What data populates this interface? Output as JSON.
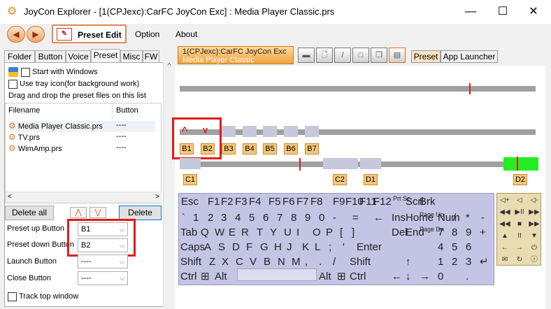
{
  "window": {
    "title": "JoyCon Explorer - [1(CPJexc):CarFC JoyCon Exc] : Media Player Classic.prs",
    "minimize": "—",
    "maximize": "☐",
    "close": "✕"
  },
  "menubar": {
    "back": "◀",
    "forward": "▶",
    "preset_edit": "Preset Edit",
    "option": "Option",
    "about": "About"
  },
  "left_tabs": [
    "Folder",
    "Button",
    "Voice",
    "Preset",
    "Misc",
    "FW"
  ],
  "left_panel": {
    "start_with_windows": "Start with Windows",
    "use_tray": "Use tray icon(for background work)",
    "drag_hint": "Drag and drop the preset files on this list",
    "col_filename": "Filename",
    "col_button": "Button",
    "files": [
      {
        "name": "Media Player Classic.prs",
        "button": "----"
      },
      {
        "name": "TV.prs",
        "button": "----"
      },
      {
        "name": "WimAmp.prs",
        "button": "----"
      }
    ],
    "delete_all": "Delete all",
    "up": "⋀",
    "down": "⋁",
    "delete": "Delete",
    "preset_up_label": "Preset up Button",
    "preset_up_value": "B1",
    "preset_down_label": "Preset down Button",
    "preset_down_value": "B2",
    "launch_label": "Launch Button",
    "launch_value": "----",
    "close_label": "Close Button",
    "close_value": "----",
    "track_top": "Track top window"
  },
  "right": {
    "active_tab_line1": "1(CPJexc):CarFC JoyCon Exc",
    "active_tab_line2": "Media Player Classic",
    "tab_preset": "Preset",
    "tab_launcher": "App Launcher",
    "buttons": [
      "B1",
      "B2",
      "B3",
      "B4",
      "B5",
      "B6",
      "B7"
    ],
    "lower_labels": [
      "C1",
      "C2",
      "D1",
      "D2"
    ],
    "up_caret": "^",
    "down_caret": "v"
  },
  "keyboard": {
    "row0": [
      "Esc",
      "F1",
      "F2",
      "F3",
      "F4",
      "F5",
      "F6",
      "F7",
      "F8",
      "F9",
      "F10",
      "F11",
      "F12",
      "Prt Sc",
      "Scrl",
      "Brk"
    ],
    "row1": [
      "`",
      "1",
      "2",
      "3",
      "4",
      "5",
      "6",
      "7",
      "8",
      "9",
      "0",
      "-",
      "=",
      "←",
      "Ins",
      "Home",
      "Page Up",
      "Num",
      "/",
      "*",
      "-"
    ],
    "row2": [
      "Tab",
      "Q",
      "W",
      "E",
      "R",
      "T",
      "Y",
      "U",
      "I",
      "O",
      "P",
      "[",
      "]",
      "Del",
      "End",
      "Page Dn",
      "7",
      "8",
      "9",
      "+"
    ],
    "row3": [
      "Caps",
      "A",
      "S",
      "D",
      "F",
      "G",
      "H",
      "J",
      "K",
      "L",
      ";",
      "'",
      "Enter",
      "4",
      "5",
      "6"
    ],
    "row4": [
      "Shift",
      "Z",
      "X",
      "C",
      "V",
      "B",
      "N",
      "M",
      ",",
      ".",
      "/",
      "Shift",
      "↑",
      "1",
      "2",
      "3",
      "↵"
    ],
    "row5": [
      "Ctrl",
      "⊞",
      "Alt",
      "Alt",
      "⊞",
      "Ctrl",
      "←",
      "↓",
      "→",
      "0",
      "."
    ]
  },
  "media_keys": [
    "◁+",
    "◁",
    "◁-",
    "◀◀",
    "▶II",
    "▶▶",
    "◀◀",
    "■",
    "▶▶",
    "▲",
    "II",
    "▼",
    "←",
    "→",
    "⏻",
    "✉",
    "↻",
    "ⓘ"
  ],
  "colors": {
    "accent": "#f0a23c",
    "highlight": "#e31a1a",
    "green": "#22ee22"
  }
}
